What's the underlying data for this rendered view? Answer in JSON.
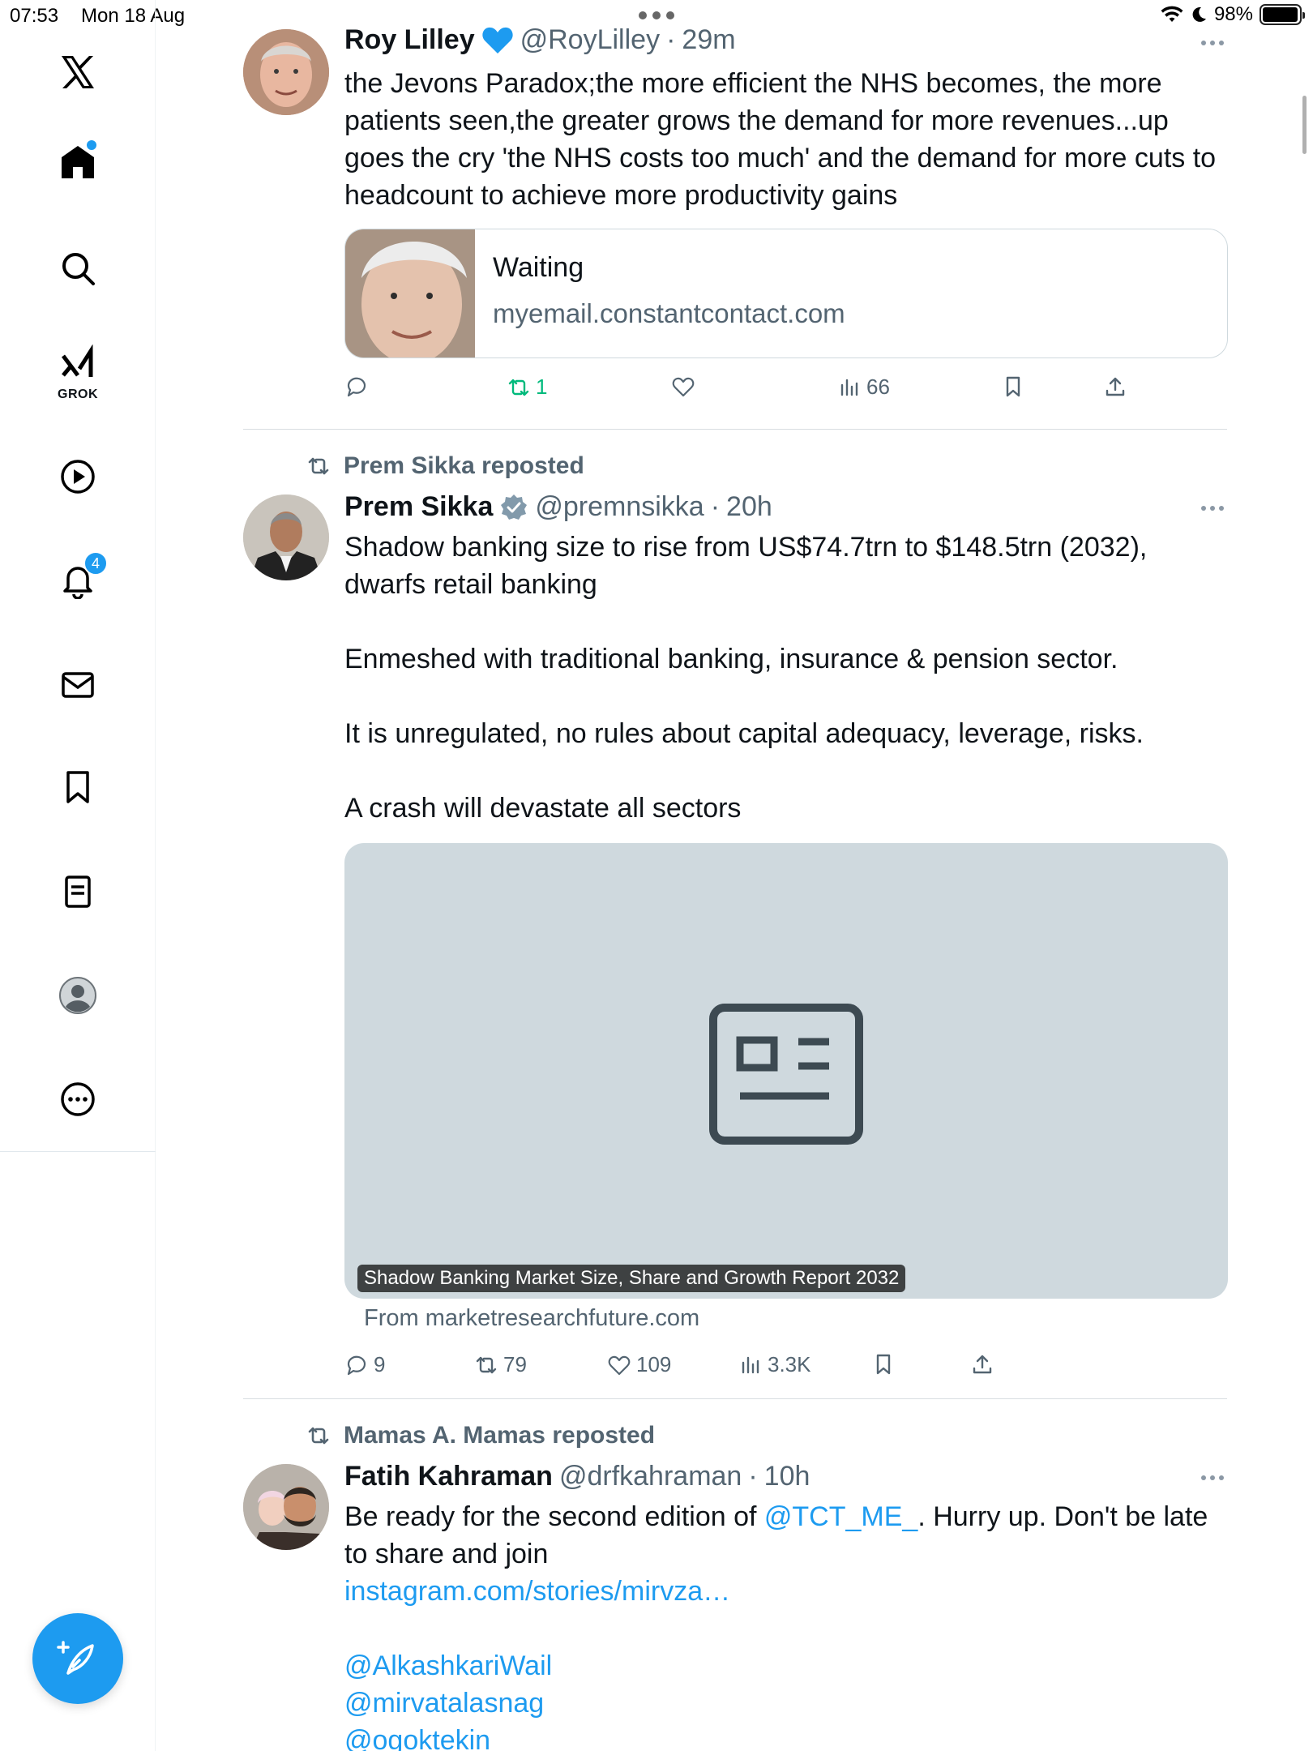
{
  "status_bar": {
    "time": "07:53",
    "date": "Mon 18 Aug",
    "battery": "98%",
    "battery_level": 0.98
  },
  "sidebar": {
    "logo_icon": "x-logo-icon",
    "grok_label": "GROK",
    "notifications_badge": "4",
    "items": [
      "home-icon",
      "search-icon",
      "grok-icon",
      "video-icon",
      "notifications-icon",
      "messages-icon",
      "bookmarks-icon",
      "lists-icon",
      "profile-icon",
      "more-icon"
    ],
    "compose_icon": "compose-icon"
  },
  "tweets": [
    {
      "name": "Roy Lilley",
      "handle": "@RoyLilley",
      "separator": "·",
      "time": "29m",
      "text": "the Jevons Paradox;the more efficient the NHS becomes, the more patients seen,the greater grows the demand for more revenues...up goes the cry 'the NHS costs too much' and the demand for more cuts to headcount to achieve more productivity gains",
      "card": {
        "title": "Waiting",
        "domain": "myemail.constantcontact.com"
      },
      "stats": {
        "replies": "",
        "reposts": "1",
        "likes": "",
        "views": "66"
      }
    },
    {
      "repost_by": "Prem Sikka reposted",
      "name": "Prem Sikka",
      "handle": "@premnsikka",
      "separator": "·",
      "time": "20h",
      "paragraphs": [
        "Shadow banking size to rise from US$74.7trn to $148.5trn (2032), dwarfs retail banking",
        "Enmeshed with traditional banking, insurance & pension sector.",
        "It is unregulated, no rules about capital adequacy, leverage, risks.",
        "A crash will devastate all sectors"
      ],
      "media": {
        "caption": "Shadow Banking Market Size, Share and Growth Report 2032",
        "from": "From marketresearchfuture.com"
      },
      "stats": {
        "replies": "9",
        "reposts": "79",
        "likes": "109",
        "views": "3.3K"
      }
    },
    {
      "repost_by": "Mamas A. Mamas reposted",
      "name": "Fatih Kahraman",
      "handle": "@drfkahraman",
      "separator": "·",
      "time": "10h",
      "text_before": "Be ready for the second edition of ",
      "mention": "@TCT_ME_",
      "text_after": ". Hurry up. Don't be late to share and join",
      "link": "instagram.com/stories/mirvza…",
      "mentions": [
        "@AlkashkariWail",
        "@mirvatalasnag",
        "@ogoktekin"
      ]
    }
  ],
  "colors": {
    "accent": "#1d9bf0",
    "repost_green": "#00ba7c",
    "secondary_text": "#536471",
    "media_placeholder": "#cfd9de"
  }
}
